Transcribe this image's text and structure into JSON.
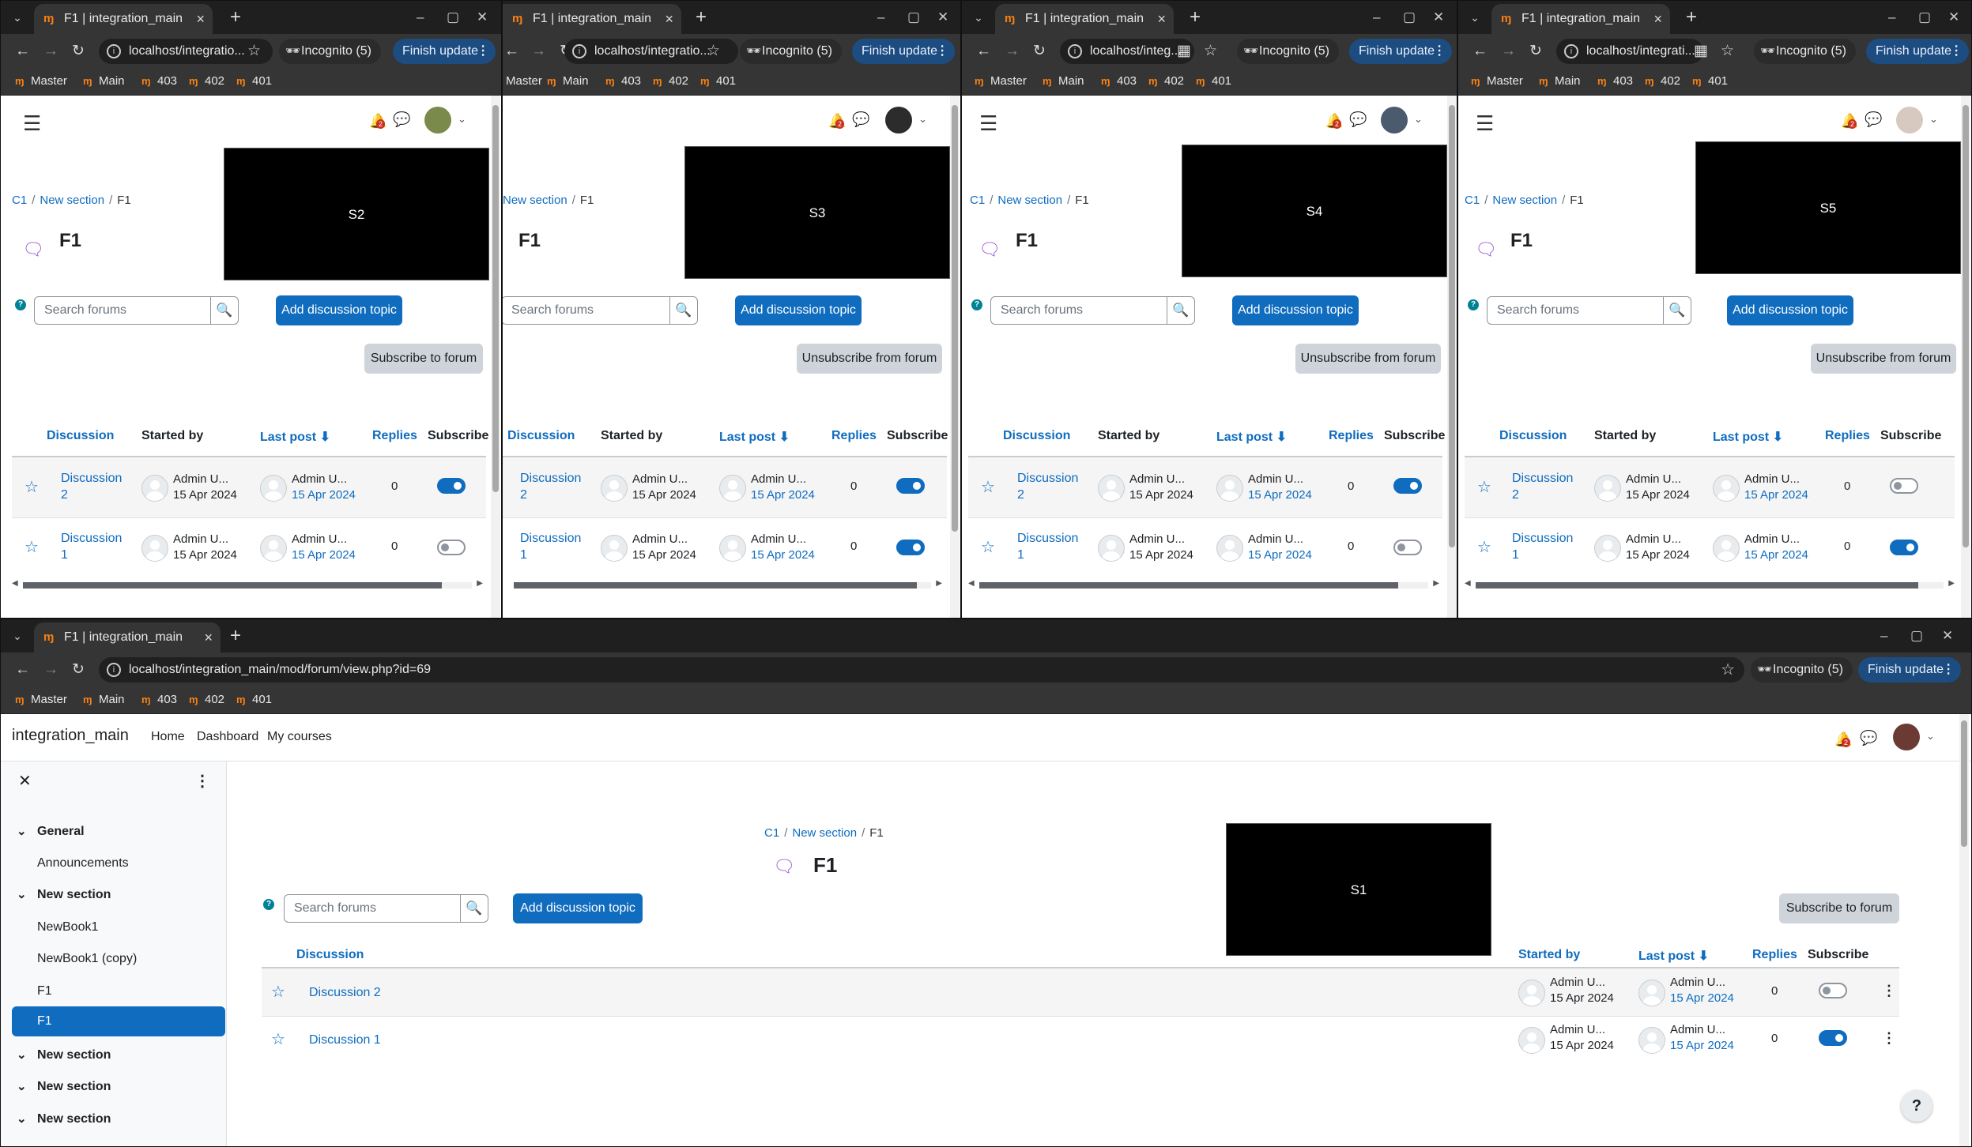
{
  "browser": {
    "tab_title": "F1 | integration_main",
    "incognito_label": "Incognito (5)",
    "finish_update_label": "Finish update",
    "bookmarks": [
      "Master",
      "Main",
      "403",
      "402",
      "401"
    ],
    "url_short_1": "localhost/integratio...",
    "url_short_2": "localhost/integratio...",
    "url_short_3": "localhost/integ...",
    "url_short_4": "localhost/integrati...",
    "url_full": "localhost/integration_main/mod/forum/view.php?id=69"
  },
  "moodle": {
    "site_name": "integration_main",
    "nav": [
      "Home",
      "Dashboard",
      "My courses"
    ],
    "notification_count": "2",
    "breadcrumb": [
      "C1",
      "New section",
      "F1"
    ],
    "page_title": "F1",
    "search_placeholder": "Search forums",
    "add_topic_label": "Add discussion topic",
    "subscribe_label": "Subscribe to forum",
    "unsubscribe_label": "Unsubscribe from forum",
    "columns": {
      "discussion": "Discussion",
      "started_by": "Started by",
      "last_post": "Last post",
      "replies": "Replies",
      "subscribe": "Subscribe"
    },
    "rows": [
      {
        "title": "Discussion 2",
        "title_line1": "Discussion",
        "title_line2": "2",
        "author": "Admin U...",
        "date": "15 Apr 2024",
        "replies": "0"
      },
      {
        "title": "Discussion 1",
        "title_line1": "Discussion",
        "title_line2": "1",
        "author": "Admin U...",
        "date": "15 Apr 2024",
        "replies": "0"
      }
    ]
  },
  "screens": {
    "s1": "S1",
    "s2": "S2",
    "s3": "S3",
    "s4": "S4",
    "s5": "S5"
  },
  "windows": {
    "w1": {
      "subscription_button": "subscribe",
      "toggles": [
        true,
        false
      ]
    },
    "w2": {
      "subscription_button": "unsubscribe",
      "toggles": [
        true,
        true
      ]
    },
    "w3": {
      "subscription_button": "unsubscribe",
      "toggles": [
        true,
        false
      ]
    },
    "w4": {
      "subscription_button": "unsubscribe",
      "toggles": [
        false,
        true
      ]
    },
    "main": {
      "subscription_button": "subscribe",
      "toggles": [
        false,
        true
      ]
    }
  },
  "drawer": {
    "sections": [
      {
        "label": "General",
        "items": [
          "Announcements"
        ]
      },
      {
        "label": "New section",
        "items": [
          "NewBook1",
          "NewBook1 (copy)",
          "F1",
          "F1"
        ]
      },
      {
        "label": "New section",
        "items": []
      },
      {
        "label": "New section",
        "items": []
      },
      {
        "label": "New section",
        "items": []
      }
    ]
  },
  "help_fab": "?"
}
